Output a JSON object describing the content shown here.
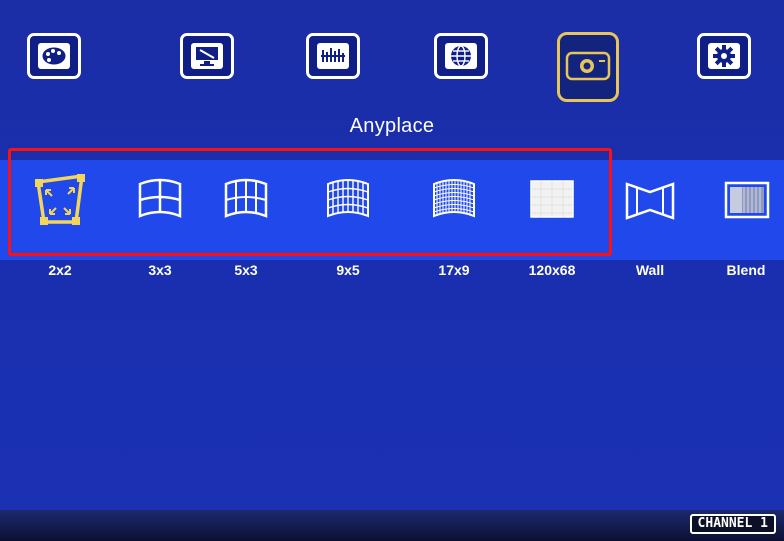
{
  "menu": {
    "title": "Anyplace",
    "top_icons": [
      {
        "icon": "palette-icon"
      },
      {
        "icon": "monitor-tools-icon"
      },
      {
        "icon": "equalizer-icon"
      },
      {
        "icon": "globe-icon"
      },
      {
        "icon": "projector-icon",
        "selected": true
      },
      {
        "icon": "gear-icon"
      }
    ]
  },
  "modes": [
    {
      "label": "2x2",
      "selected": true
    },
    {
      "label": "3x3"
    },
    {
      "label": "5x3"
    },
    {
      "label": "9x5"
    },
    {
      "label": "17x9"
    },
    {
      "label": "120x68"
    },
    {
      "label": "Wall"
    },
    {
      "label": "Blend"
    }
  ],
  "status": {
    "channel": "CHANNEL 1"
  },
  "colors": {
    "background": "#1a2fa8",
    "highlight": "#e6c65a",
    "annotation": "#ff1010"
  }
}
